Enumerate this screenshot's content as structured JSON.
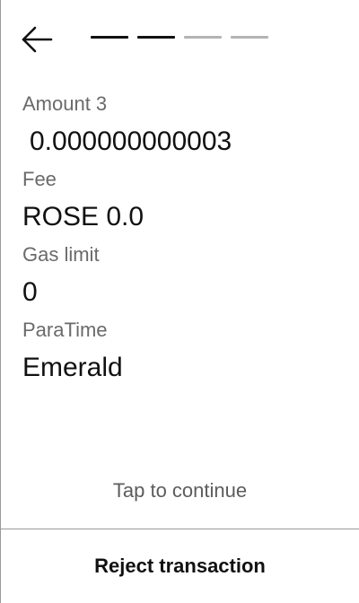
{
  "header": {
    "back_icon": "arrow-left-icon",
    "steps": [
      {
        "state": "done",
        "color": "#111111"
      },
      {
        "state": "done",
        "color": "#111111"
      },
      {
        "state": "pending",
        "color": "#b4b4b4"
      },
      {
        "state": "pending",
        "color": "#b4b4b4"
      }
    ],
    "progress_fraction": 0.5
  },
  "fields": {
    "amount": {
      "label": "Amount 3",
      "value": "0.000000000003"
    },
    "fee": {
      "label": "Fee",
      "value": "ROSE 0.0"
    },
    "gas_limit": {
      "label": "Gas limit",
      "value": "0"
    },
    "paratime": {
      "label": "ParaTime",
      "value": "Emerald"
    }
  },
  "footer": {
    "continue_label": "Tap to continue",
    "reject_label": "Reject transaction"
  }
}
